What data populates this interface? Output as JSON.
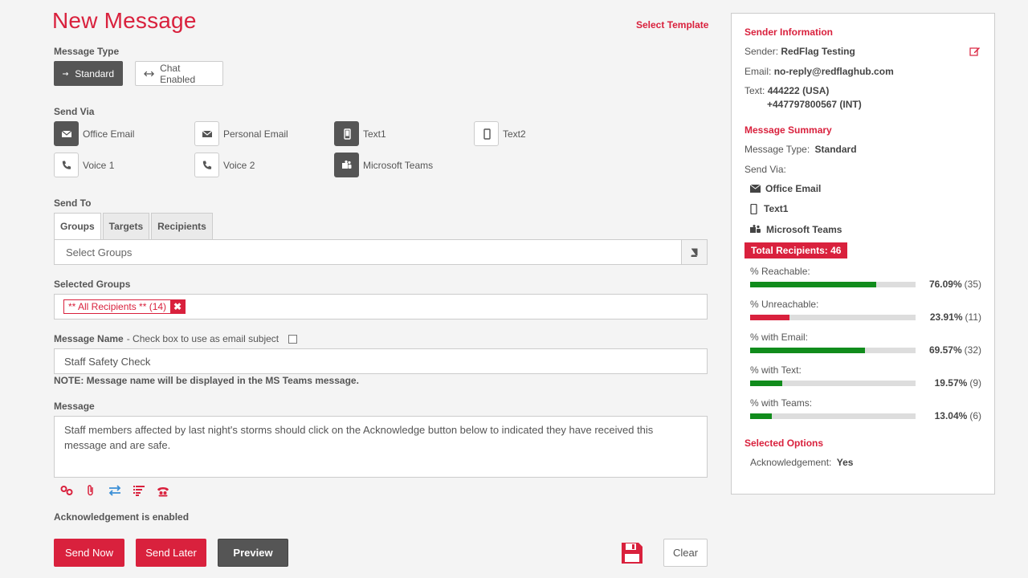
{
  "page": {
    "title": "New Message",
    "select_template": "Select Template"
  },
  "message_type": {
    "label": "Message Type",
    "options": [
      {
        "label": "Standard",
        "active": true
      },
      {
        "label": "Chat Enabled",
        "active": false
      }
    ]
  },
  "send_via": {
    "label": "Send Via",
    "channels": [
      {
        "label": "Office Email",
        "icon": "envelope-icon",
        "selected": true
      },
      {
        "label": "Personal Email",
        "icon": "envelope-icon",
        "selected": false
      },
      {
        "label": "Text1",
        "icon": "mobile-icon",
        "selected": true
      },
      {
        "label": "Text2",
        "icon": "mobile-icon",
        "selected": false
      },
      {
        "label": "Voice 1",
        "icon": "phone-icon",
        "selected": false
      },
      {
        "label": "Voice 2",
        "icon": "phone-icon",
        "selected": false
      },
      {
        "label": "Microsoft Teams",
        "icon": "teams-icon",
        "selected": true
      }
    ]
  },
  "send_to": {
    "label": "Send To",
    "tabs": [
      "Groups",
      "Targets",
      "Recipients"
    ],
    "active_tab": "Groups",
    "select_placeholder": "Select Groups",
    "selected_label": "Selected Groups",
    "selected_tag": "** All Recipients ** (14)",
    "tag_remove": "✖"
  },
  "message_name": {
    "label": "Message Name",
    "hint": "- Check box to use as email subject",
    "value": "Staff Safety Check",
    "note": "NOTE: Message name will be displayed in the MS Teams message."
  },
  "message": {
    "label": "Message",
    "value": "Staff members affected by last night's storms should click on  the Acknowledge button below to indicated they have received this message and are safe.",
    "toolbar_icons": [
      "link-icon",
      "paperclip-icon",
      "swap-icon",
      "list-icon",
      "people-icon"
    ],
    "ack_enabled": "Acknowledgement is enabled"
  },
  "actions": {
    "send_now": "Send Now",
    "send_later": "Send Later",
    "preview": "Preview",
    "clear": "Clear"
  },
  "sidebar": {
    "sender_header": "Sender Information",
    "sender_label": "Sender:",
    "sender_value": "RedFlag Testing",
    "email_label": "Email:",
    "email_value": "no-reply@redflaghub.com",
    "text_label": "Text:",
    "text_value_1": "444222 (USA)",
    "text_value_2": "+447797800567 (INT)",
    "summary_header": "Message Summary",
    "type_label": "Message Type:",
    "type_value": "Standard",
    "send_via_label": "Send Via:",
    "send_via_items": [
      {
        "label": "Office Email",
        "icon": "envelope-icon"
      },
      {
        "label": "Text1",
        "icon": "mobile-icon"
      },
      {
        "label": "Microsoft Teams",
        "icon": "teams-icon"
      }
    ],
    "total_recipients": "Total Recipients:  46",
    "stats": [
      {
        "label": "% Reachable:",
        "percent": "76.09%",
        "count": "(35)",
        "fraction": 0.7609,
        "color": "#118c1c"
      },
      {
        "label": "% Unreachable:",
        "percent": "23.91%",
        "count": "(11)",
        "fraction": 0.2391,
        "color": "#d9213d"
      },
      {
        "label": "% with Email:",
        "percent": "69.57%",
        "count": "(32)",
        "fraction": 0.6957,
        "color": "#118c1c"
      },
      {
        "label": "% with Text:",
        "percent": "19.57%",
        "count": "(9)",
        "fraction": 0.1957,
        "color": "#118c1c"
      },
      {
        "label": "% with Teams:",
        "percent": "13.04%",
        "count": "(6)",
        "fraction": 0.1304,
        "color": "#118c1c"
      }
    ],
    "options_header": "Selected Options",
    "ack_label": "Acknowledgement:",
    "ack_value": "Yes"
  }
}
